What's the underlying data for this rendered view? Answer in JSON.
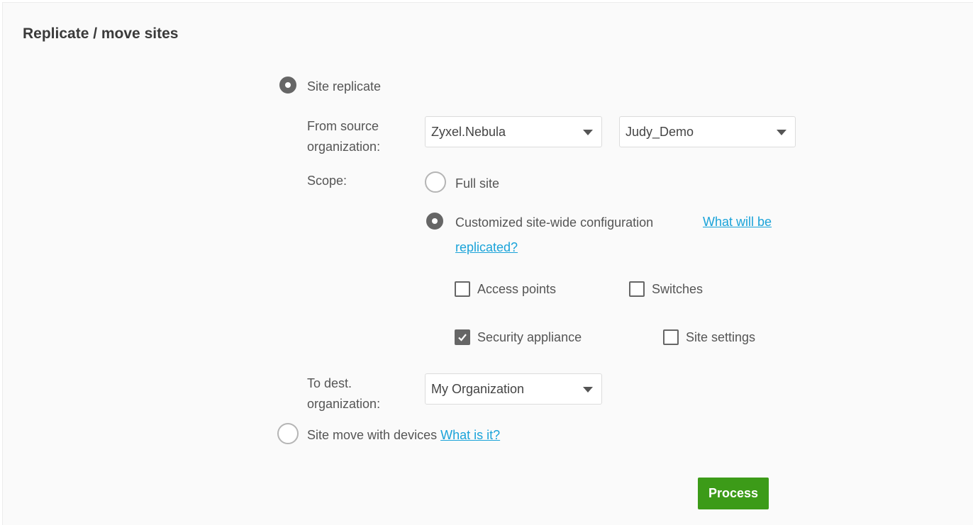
{
  "page": {
    "title": "Replicate / move sites"
  },
  "site_replicate": {
    "label": "Site replicate",
    "checked": true,
    "source": {
      "label_line1": "From source",
      "label_line2": "organization:",
      "org_value": "Zyxel.Nebula",
      "site_value": "Judy_Demo"
    },
    "scope": {
      "label": "Scope:",
      "full_site": {
        "label": "Full site",
        "checked": false
      },
      "customized": {
        "label": "Customized site-wide configuration",
        "checked": true,
        "link_line1": "What will be",
        "link_line2": "replicated?"
      },
      "options": {
        "access_points": {
          "label": "Access points",
          "checked": false
        },
        "switches": {
          "label": "Switches",
          "checked": false
        },
        "security_appliance": {
          "label": "Security appliance",
          "checked": true
        },
        "site_settings": {
          "label": "Site settings",
          "checked": false
        }
      }
    },
    "dest": {
      "label_line1": "To dest.",
      "label_line2": "organization:",
      "org_value": "My Organization"
    }
  },
  "site_move": {
    "label": "Site move with devices",
    "link": "What is it?",
    "checked": false
  },
  "process_button": {
    "label": "Process"
  },
  "colors": {
    "accent_green": "#3c9b18",
    "link_blue": "#1aa3d9",
    "checked_gray": "#666666"
  }
}
